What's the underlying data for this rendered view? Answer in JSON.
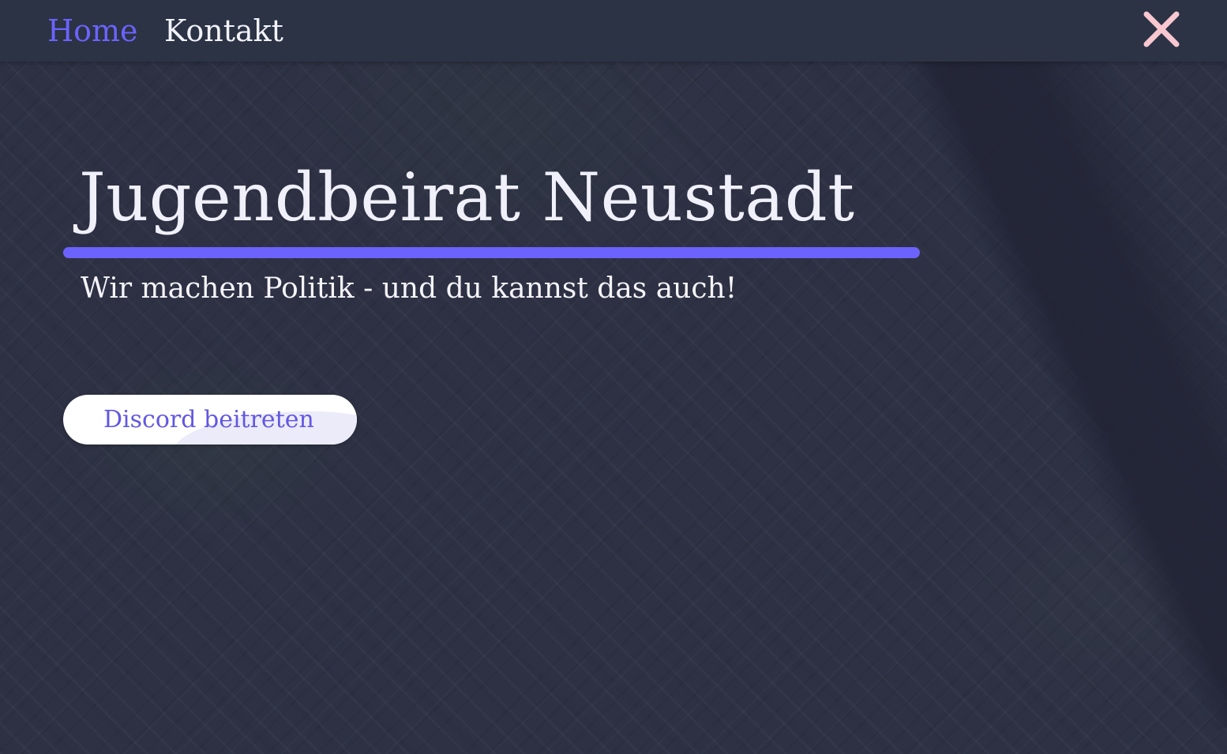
{
  "nav": {
    "items": [
      {
        "label": "Home",
        "active": true
      },
      {
        "label": "Kontakt",
        "active": false
      }
    ],
    "close_icon": "close-icon"
  },
  "hero": {
    "title": "Jugendbeirat Neustadt",
    "subtitle": "Wir machen Politik - und du kannst das auch!",
    "cta_label": "Discord beitreten"
  },
  "colors": {
    "accent": "#6c63ff",
    "nav_background": "#2b3345",
    "close_icon": "#f8c7d0",
    "text_light": "#f0f0fa",
    "button_background": "#ffffff"
  }
}
